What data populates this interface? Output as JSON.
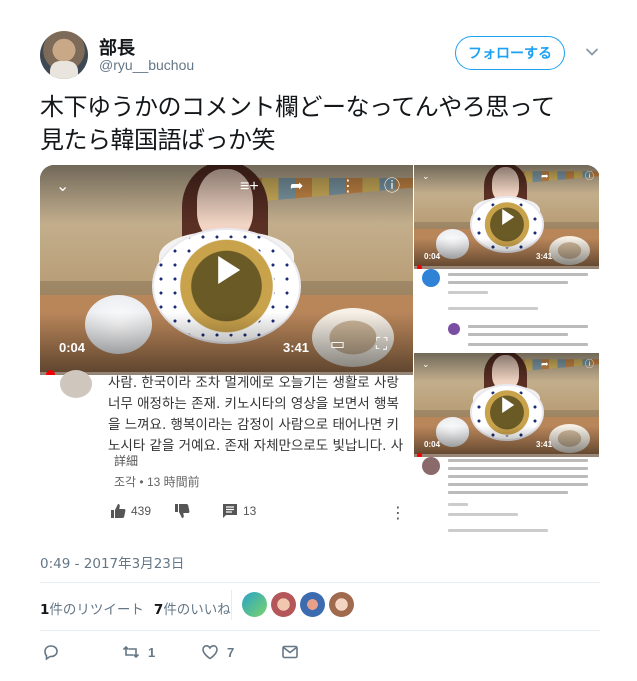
{
  "header": {
    "display_name": "部長",
    "handle": "@ryu__buchou",
    "follow_label": "フォローする"
  },
  "tweet": {
    "text_line1": "木下ゆうかのコメント欄どーなってんやろ思って",
    "text_line2": "見たら韓国語ばっか笑",
    "timestamp": "0:49 - 2017年3月23日"
  },
  "main_video": {
    "elapsed": "0:04",
    "duration": "3:41",
    "progress_fraction": 0.02
  },
  "main_comment": {
    "text": "사람. 한국이라 조차 멀게에로 오늘기는 생활로 사랑 너무 애정하는 존재. 키노시타의 영상을 보면서 행복을 느껴요. 행복이라는 감정이 사람으로 태어나면 키노시타 같을 거예요. 존재 자체만으로도 빛납니다. 사",
    "more_label": "詳細",
    "author_time": "조각 • 13 時間前",
    "likes": "439",
    "replies": "13"
  },
  "side_videos": [
    {
      "elapsed": "0:04",
      "duration": "3:41"
    },
    {
      "elapsed": "0:04",
      "duration": "3:41"
    }
  ],
  "stats": {
    "retweet_count": "1",
    "retweet_label": "件のリツイート",
    "like_count": "7",
    "like_label": "件のいいね"
  },
  "actions": {
    "retweet_count": "1",
    "like_count": "7"
  },
  "colors": {
    "accent": "#1da1f2",
    "secondary_text": "#657786",
    "divider": "#e6ecf0"
  },
  "icons": [
    "caret-down-icon",
    "reply-icon",
    "retweet-icon",
    "like-icon",
    "message-icon",
    "play-icon",
    "share-icon",
    "info-icon",
    "fullscreen-icon",
    "cast-icon",
    "thumbs-up-icon",
    "thumbs-down-icon",
    "comment-icon",
    "kebab-menu-icon"
  ]
}
